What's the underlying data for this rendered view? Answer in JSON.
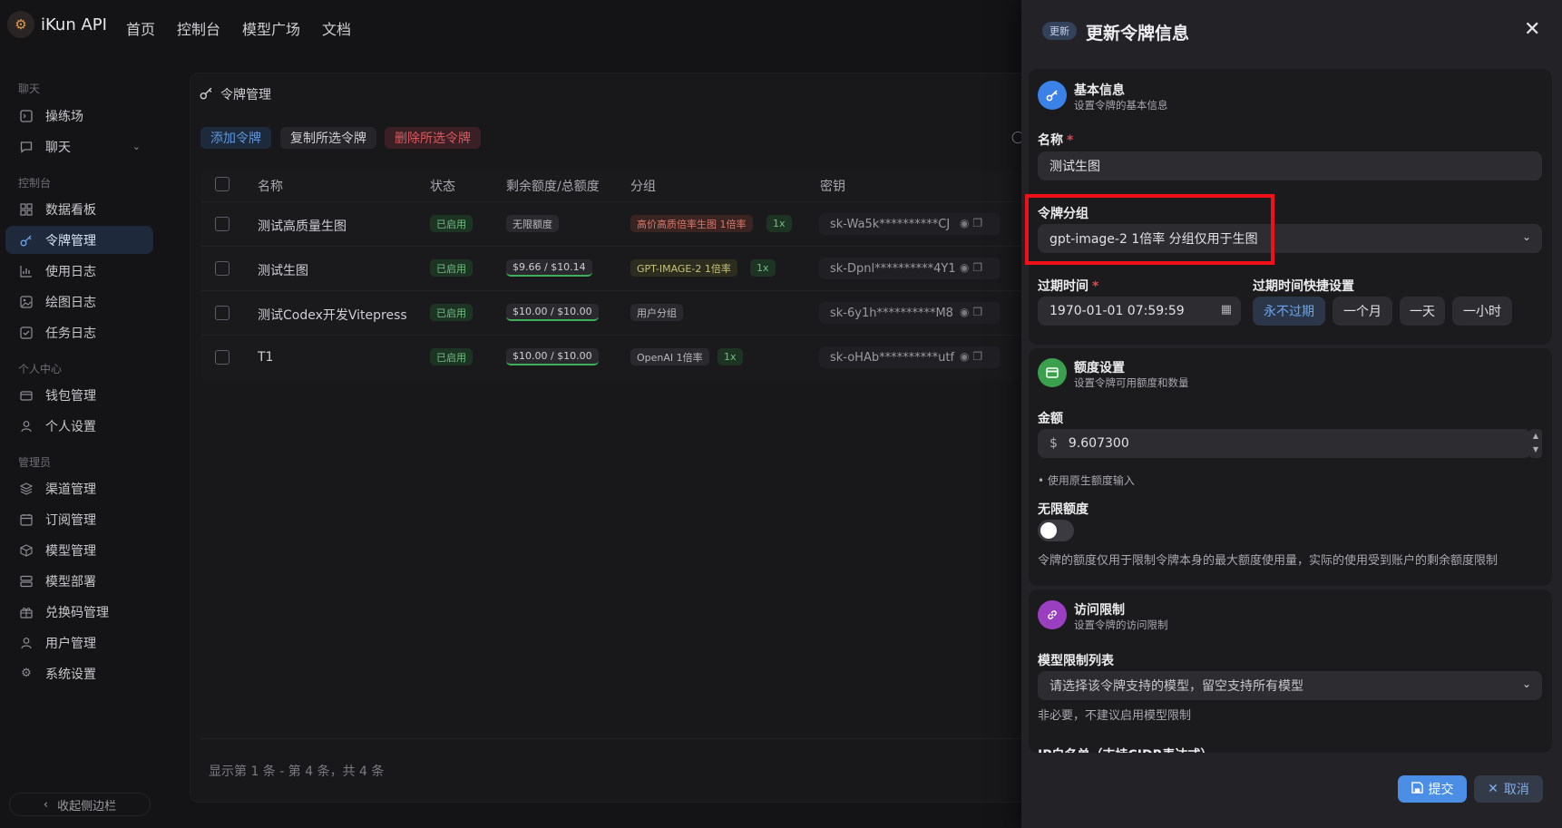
{
  "app": {
    "name": "iKun API"
  },
  "nav": [
    "首页",
    "控制台",
    "模型广场",
    "文档"
  ],
  "sidebar": {
    "sections": [
      {
        "label": "聊天",
        "items": [
          {
            "label": "操练场",
            "icon": "playground-icon"
          },
          {
            "label": "聊天",
            "icon": "chat-icon"
          }
        ]
      },
      {
        "label": "控制台",
        "items": [
          {
            "label": "数据看板",
            "icon": "dashboard-icon"
          },
          {
            "label": "令牌管理",
            "icon": "key-icon"
          },
          {
            "label": "使用日志",
            "icon": "chart-icon"
          },
          {
            "label": "绘图日志",
            "icon": "image-icon"
          },
          {
            "label": "任务日志",
            "icon": "task-icon"
          }
        ]
      },
      {
        "label": "个人中心",
        "items": [
          {
            "label": "钱包管理",
            "icon": "wallet-icon"
          },
          {
            "label": "个人设置",
            "icon": "user-icon"
          }
        ]
      },
      {
        "label": "管理员",
        "items": [
          {
            "label": "渠道管理",
            "icon": "layers-icon"
          },
          {
            "label": "订阅管理",
            "icon": "calendar-icon"
          },
          {
            "label": "模型管理",
            "icon": "box-icon"
          },
          {
            "label": "模型部署",
            "icon": "server-icon"
          },
          {
            "label": "兑换码管理",
            "icon": "gift-icon"
          },
          {
            "label": "用户管理",
            "icon": "user-icon"
          },
          {
            "label": "系统设置",
            "icon": "gear-icon"
          }
        ]
      }
    ],
    "collapse_label": "收起侧边栏"
  },
  "tokens": {
    "title": "令牌管理",
    "actions": {
      "add": "添加令牌",
      "copy": "复制所选令牌",
      "delete": "删除所选令牌"
    },
    "columns": [
      "名称",
      "状态",
      "剩余额度/总额度",
      "分组",
      "密钥"
    ],
    "rows": [
      {
        "name": "测试高质量生图",
        "status": "已启用",
        "quota": "无限额度",
        "group": "高价高质倍率生图 1倍率",
        "ratio": "1x",
        "key": "sk-Wa5k**********CJ"
      },
      {
        "name": "测试生图",
        "status": "已启用",
        "quota": "$9.66 / $10.14",
        "group": "GPT-IMAGE-2 1倍率",
        "ratio": "1x",
        "key": "sk-Dpnl**********4Y1"
      },
      {
        "name": "测试Codex开发Vitepress",
        "status": "已启用",
        "quota": "$10.00 / $10.00",
        "group": "用户分组",
        "ratio": "",
        "key": "sk-6y1h**********M8"
      },
      {
        "name": "T1",
        "status": "已启用",
        "quota": "$10.00 / $10.00",
        "group": "OpenAI 1倍率",
        "ratio": "1x",
        "key": "sk-oHAb**********utf"
      }
    ],
    "footer": "显示第 1 条 - 第 4 条，共 4 条"
  },
  "drawer": {
    "badge": "更新",
    "title": "更新令牌信息",
    "basic": {
      "title": "基本信息",
      "subtitle": "设置令牌的基本信息"
    },
    "name": {
      "label": "名称",
      "required": "*",
      "value": "测试生图"
    },
    "group": {
      "label": "令牌分组",
      "value": "gpt-image-2 1倍率 分组仅用于生图"
    },
    "expire": {
      "label": "过期时间",
      "required": "*",
      "value": "1970-01-01 07:59:59",
      "quick_label": "过期时间快捷设置",
      "quick": [
        "永不过期",
        "一个月",
        "一天",
        "一小时"
      ]
    },
    "quota": {
      "title": "额度设置",
      "subtitle": "设置令牌可用额度和数量",
      "amount_label": "金额",
      "currency": "$",
      "amount": "9.607300",
      "raw_hint": "• 使用原生额度输入",
      "unlimited_label": "无限额度",
      "unlimited": false,
      "note": "令牌的额度仅用于限制令牌本身的最大额度使用量，实际的使用受到账户的剩余额度限制"
    },
    "access": {
      "title": "访问限制",
      "subtitle": "设置令牌的访问限制",
      "models_label": "模型限制列表",
      "models_placeholder": "请选择该令牌支持的模型，留空支持所有模型",
      "models_hint": "非必要，不建议启用模型限制",
      "ip_label": "IP白名单（支持CIDR表达式）"
    },
    "submit": "提交",
    "cancel": "取消"
  }
}
